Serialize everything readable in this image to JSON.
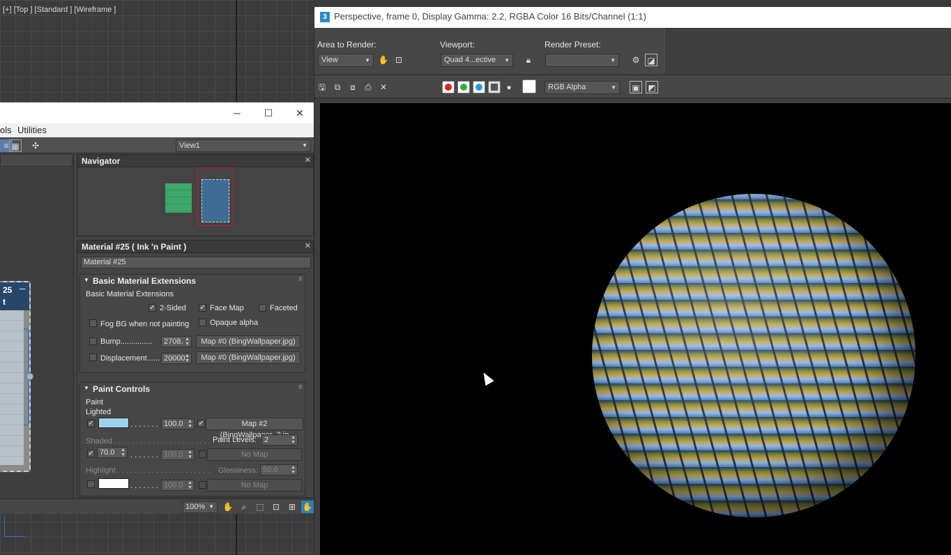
{
  "viewport": {
    "label": "[+] [Top ] [Standard ] [Wireframe ]"
  },
  "slate": {
    "menu": [
      "ols",
      "Utilities"
    ],
    "view_select": "View1",
    "node": {
      "title_line1": "25",
      "title_line2": "t"
    },
    "navigator": {
      "title": "Navigator"
    },
    "material": {
      "title": "Material #25  ( Ink 'n Paint )",
      "name_field": "Material #25",
      "basic_ext": {
        "rollout_title": "Basic Material Extensions",
        "group_label": "Basic Material Extensions",
        "two_sided": "2-Sided",
        "face_map": "Face Map",
        "faceted": "Faceted",
        "fog_bg": "Fog BG when not painting",
        "opaque_alpha": "Opaque alpha",
        "bump_label": "Bump...............",
        "bump_value": "2708.",
        "bump_map": "Map #0 (BingWallpaper.jpg)",
        "disp_label": "Displacement......",
        "disp_value": "20000",
        "disp_map": "Map #0 (BingWallpaper.jpg)"
      },
      "paint_controls": {
        "rollout_title": "Paint Controls",
        "paint": "Paint",
        "lighted": "Lighted",
        "lighted_amount": "100.0",
        "lighted_map": "Map #2 (BingWallpaper_2.jp",
        "lighted_color": "#9cd3ea",
        "shaded": "Shaded . . . . . . . . . . . . . . . . . . . . . . . .",
        "paint_levels_label": "Paint Levels:",
        "paint_levels": "2",
        "shaded_value": "70.0",
        "shaded_amount": "100.0",
        "shaded_map": "No Map",
        "highlight": "Highlight . . . . . . . . . . . . . . . . . . . . . .",
        "glossiness_label": "Glossiness:",
        "glossiness": "50.0",
        "highlight_amount": "100.0",
        "highlight_map": "No Map",
        "highlight_color": "#ffffff",
        "dots": ". . . . . . ."
      }
    },
    "zoom": "100%"
  },
  "render": {
    "title": "Perspective, frame 0, Display Gamma: 2.2, RGBA Color 16 Bits/Channel (1:1)",
    "area_label": "Area to Render:",
    "area_value": "View",
    "viewport_label": "Viewport:",
    "viewport_value": "Quad 4...ective",
    "preset_label": "Render Preset:",
    "preset_value": "",
    "channel_select": "RGB Alpha",
    "channel_colors": {
      "red": "#e02020",
      "green": "#2fae3a",
      "blue": "#1e9ee0"
    }
  }
}
